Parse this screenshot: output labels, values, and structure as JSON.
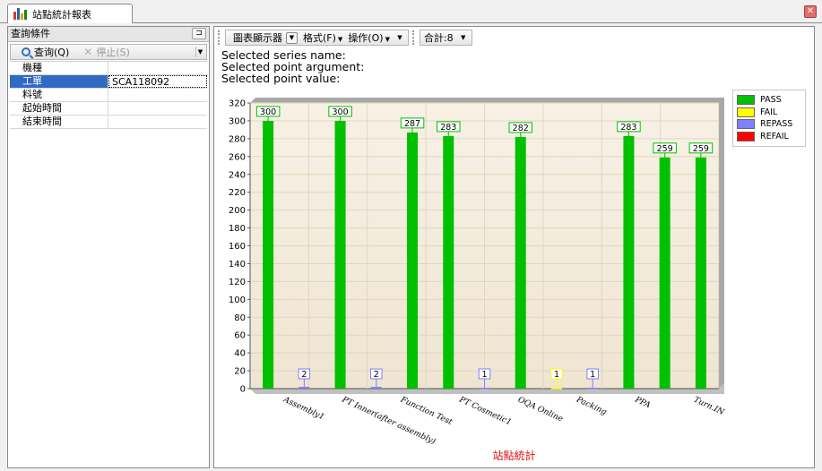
{
  "tab": {
    "title": "站點統計報表",
    "icon": "bar-chart-icon",
    "close_glyph": "✕"
  },
  "left": {
    "header": "查詢條件",
    "pin_icon": "pin-icon",
    "toolbar": {
      "query_label": "查询(Q)",
      "stop_label": "停止(S)"
    },
    "fields": [
      {
        "label": "機種",
        "value": ""
      },
      {
        "label": "工單",
        "value": "SCA118092"
      },
      {
        "label": "料號",
        "value": ""
      },
      {
        "label": "起始時間",
        "value": ""
      },
      {
        "label": "結束時間",
        "value": ""
      }
    ]
  },
  "toolbar": {
    "display_combo": "圖表顯示器",
    "format_menu": "格式(F)",
    "operate_menu": "操作(O)",
    "total_label": "合計:8"
  },
  "info": {
    "series_name": "Selected series name:",
    "point_argument": "Selected point argument:",
    "point_value": "Selected point value:"
  },
  "colors": {
    "pass": "#00c000",
    "fail": "#ffff00",
    "repass": "#8080ff",
    "refail": "#ff0000",
    "caption": "#e01010"
  },
  "chart_data": {
    "type": "bar",
    "title": "站點統計",
    "categories": [
      "Assembly1",
      "PT Inner(after assembly)",
      "Function Test",
      "PT Cosmetic1",
      "OQA Online",
      "Packing",
      "PPA",
      "Turn.IN"
    ],
    "series": [
      {
        "name": "PASS",
        "color": "#00c000",
        "values": [
          300,
          300,
          287,
          283,
          282,
          283,
          259,
          259
        ]
      },
      {
        "name": "FAIL",
        "color": "#ffff00",
        "values": [
          0,
          0,
          0,
          0,
          1,
          0,
          0,
          0
        ]
      },
      {
        "name": "REPASS",
        "color": "#8080ff",
        "values": [
          2,
          2,
          0,
          1,
          1,
          0,
          0,
          0
        ]
      },
      {
        "name": "REFAIL",
        "color": "#ff0000",
        "values": [
          0,
          0,
          0,
          0,
          0,
          0,
          0,
          0
        ]
      }
    ],
    "bar_order": [
      {
        "series": "PASS",
        "value": 300,
        "label": "300"
      },
      {
        "series": "REPASS",
        "value": 2,
        "label": "2"
      },
      {
        "series": "PASS",
        "value": 300,
        "label": "300"
      },
      {
        "series": "REPASS",
        "value": 2,
        "label": "2"
      },
      {
        "series": "PASS",
        "value": 287,
        "label": "287"
      },
      {
        "series": "PASS",
        "value": 283,
        "label": "283"
      },
      {
        "series": "REPASS",
        "value": 1,
        "label": "1"
      },
      {
        "series": "PASS",
        "value": 282,
        "label": "282"
      },
      {
        "series": "FAIL",
        "value": 1,
        "label": "1"
      },
      {
        "series": "REPASS",
        "value": 1,
        "label": "1"
      },
      {
        "series": "PASS",
        "value": 283,
        "label": "283"
      },
      {
        "series": "PASS",
        "value": 259,
        "label": "259"
      },
      {
        "series": "PASS",
        "value": 259,
        "label": "259"
      }
    ],
    "yticks": [
      "0",
      "20",
      "40",
      "60",
      "80",
      "100",
      "120",
      "140",
      "160",
      "180",
      "200",
      "220",
      "240",
      "260",
      "280",
      "300",
      "320"
    ],
    "ylim": [
      0,
      320
    ],
    "grid": true,
    "legend_position": "top-right"
  }
}
